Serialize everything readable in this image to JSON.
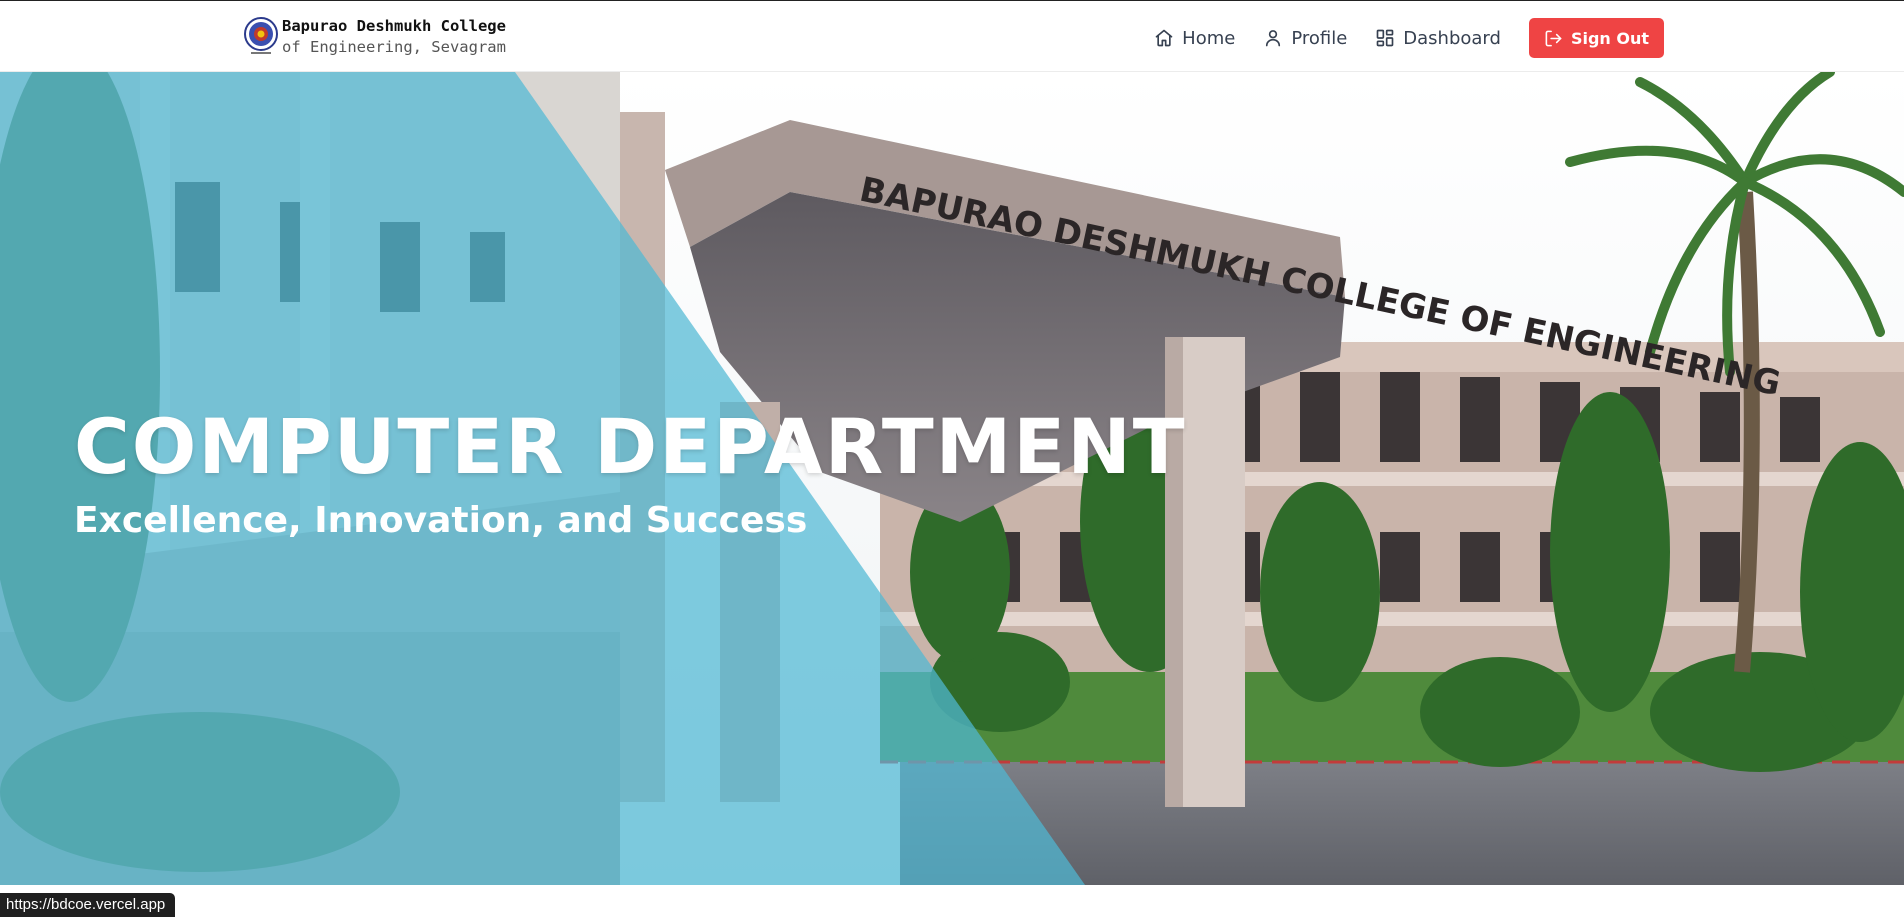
{
  "brand": {
    "line1": "Bapurao Deshmukh College",
    "line2": "of Engineering, Sevagram"
  },
  "nav": {
    "home": "Home",
    "profile": "Profile",
    "dashboard": "Dashboard",
    "signout": "Sign Out"
  },
  "hero": {
    "title": "COMPUTER DEPARTMENT",
    "subtitle": "Excellence, Innovation, and Success",
    "building_sign": "BAPURAO DESHMUKH COLLEGE OF ENGINEERING"
  },
  "status_bar": {
    "url": "https://bdcoe.vercel.app"
  },
  "colors": {
    "accent_red": "#ef4444",
    "overlay_teal": "#4fb8d4"
  },
  "icons": [
    "college-logo-icon",
    "home-icon",
    "user-icon",
    "dashboard-icon",
    "sign-out-icon"
  ]
}
